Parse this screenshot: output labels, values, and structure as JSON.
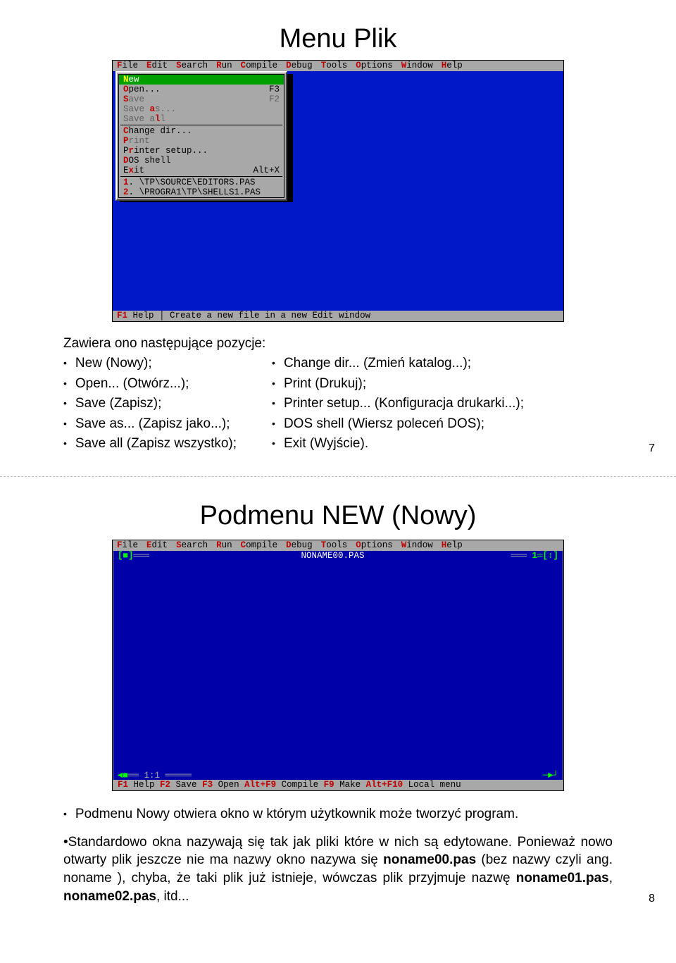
{
  "slide1": {
    "title": "Menu Plik",
    "page_num": "7",
    "screenshot": {
      "menubar": [
        "File",
        "Edit",
        "Search",
        "Run",
        "Compile",
        "Debug",
        "Tools",
        "Options",
        "Window",
        "Help"
      ],
      "dropdown": {
        "rows": [
          {
            "label": "New",
            "shortcut": "",
            "sel": true,
            "hotIdx": 0
          },
          {
            "label": "Open...",
            "shortcut": "F3",
            "hotIdx": 0
          },
          {
            "label": "Save",
            "shortcut": "F2",
            "dis": true,
            "hotIdx": 0
          },
          {
            "label": "Save as...",
            "shortcut": "",
            "dis": true,
            "hotIdx": 5
          },
          {
            "label": "Save all",
            "shortcut": "",
            "dis": true,
            "hotIdx": 6
          },
          {
            "divider": true
          },
          {
            "label": "Change dir...",
            "shortcut": "",
            "hotIdx": 0
          },
          {
            "label": "Print",
            "shortcut": "",
            "dis": true,
            "hotIdx": 0
          },
          {
            "label": "Printer setup...",
            "shortcut": "",
            "hotIdx": 1
          },
          {
            "label": "DOS shell",
            "shortcut": "",
            "hotIdx": 0
          },
          {
            "label": "Exit",
            "shortcut": "Alt+X",
            "hotIdx": 1
          },
          {
            "divider": true
          },
          {
            "label": "1. \\TP\\SOURCE\\EDITORS.PAS",
            "shortcut": "",
            "hotIdx": 0
          },
          {
            "label": "2. \\PROGRA1\\TP\\SHELLS1.PAS",
            "shortcut": "",
            "hotIdx": 0,
            "redpart": "~1~"
          }
        ]
      },
      "status_hot": "F1",
      "status_rest": " Help │ Create a new file in a new Edit window"
    },
    "intro": "Zawiera ono następujące pozycje:",
    "left_items": [
      "New (Nowy);",
      "Open... (Otwórz...);",
      "Save (Zapisz);",
      "Save as... (Zapisz jako...);",
      "Save all (Zapisz wszystko);"
    ],
    "right_items": [
      "Change dir... (Zmień katalog...);",
      "Print (Drukuj);",
      "Printer setup... (Konfiguracja drukarki...);",
      "DOS shell (Wiersz poleceń DOS);",
      "Exit (Wyjście)."
    ]
  },
  "slide2": {
    "title": "Podmenu NEW (Nowy)",
    "page_num": "8",
    "screenshot": {
      "menubar": [
        "File",
        "Edit",
        "Search",
        "Run",
        "Compile",
        "Debug",
        "Tools",
        "Options",
        "Window",
        "Help"
      ],
      "filename": "NONAME00.PAS",
      "left_mark": "[■]",
      "right_mark": "1═[↕]",
      "pos": "1:1",
      "scroll_left": "◄■",
      "scroll_right": "─►┘",
      "status": [
        {
          "hot": "F1",
          "text": " Help  "
        },
        {
          "hot": "F2",
          "text": " Save  "
        },
        {
          "hot": "F3",
          "text": " Open  "
        },
        {
          "hot": "Alt+F9",
          "text": " Compile  "
        },
        {
          "hot": "F9",
          "text": " Make  "
        },
        {
          "hot": "Alt+F10",
          "text": " Local menu"
        }
      ]
    },
    "bullet": "Podmenu Nowy otwiera okno w którym użytkownik może tworzyć program.",
    "para": "•Standardowo okna nazywają się tak jak pliki które w nich są edytowane. Ponieważ nowo otwarty plik jeszcze nie ma nazwy okno nazywa się noname00.pas (bez nazwy czyli ang. noname ), chyba, że taki plik już istnieje, wówczas plik przyjmuje nazwę noname01.pas, noname02.pas, itd...",
    "bolds": [
      "noname00.pas",
      "noname",
      "noname01.pas",
      "noname02.pas"
    ]
  }
}
